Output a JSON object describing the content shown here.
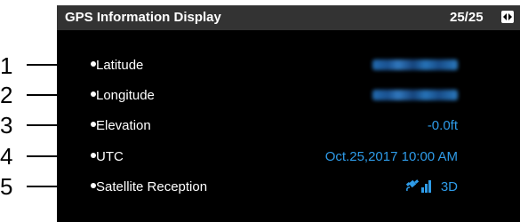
{
  "header": {
    "title": "GPS Information Display",
    "page_indicator": "25/25",
    "nav_icon": "left-right-arrows-icon"
  },
  "rows": [
    {
      "callout": "1",
      "label": "Latitude",
      "value": ""
    },
    {
      "callout": "2",
      "label": "Longitude",
      "value": ""
    },
    {
      "callout": "3",
      "label": "Elevation",
      "value": "-0.0ft"
    },
    {
      "callout": "4",
      "label": "UTC",
      "value": "Oct.25,2017 10:00 AM"
    },
    {
      "callout": "5",
      "label": "Satellite Reception",
      "value": "3D",
      "icon": "satellite-signal-icon"
    }
  ],
  "colors": {
    "value_text": "#2e9be8",
    "screen_bg": "#000000",
    "titlebar_bg": "#333333"
  }
}
